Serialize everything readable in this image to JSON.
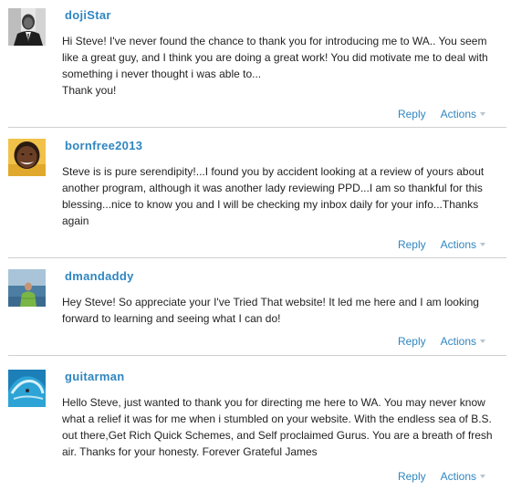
{
  "comments": [
    {
      "username": "dojiStar",
      "avatar": "avatar-man-in-suit",
      "paragraphs": [
        "Hi Steve! I've never found the chance to thank you for introducing me to WA.. You seem like a great guy, and I think you are doing a great work! You did motivate me to deal with something i never thought i was able to...",
        "Thank you!"
      ],
      "reply_label": "Reply",
      "actions_label": "Actions"
    },
    {
      "username": "bornfree2013",
      "avatar": "avatar-smiling-woman",
      "paragraphs": [
        "Steve is is pure serendipity!...I found you by accident looking at a review of yours about another program, although it was another lady reviewing PPD...I am so thankful for this blessing...nice to know you and I will be checking my inbox daily for your info...Thanks again"
      ],
      "reply_label": "Reply",
      "actions_label": "Actions"
    },
    {
      "username": "dmandaddy",
      "avatar": "avatar-man-by-sea",
      "paragraphs": [
        "Hey Steve! So appreciate your I've Tried That website! It led me here and I am looking forward to learning and seeing what I can do!"
      ],
      "reply_label": "Reply",
      "actions_label": "Actions"
    },
    {
      "username": "guitarman",
      "avatar": "avatar-ocean-wave",
      "paragraphs": [
        "Hello Steve, just wanted to thank you for directing me here to WA. You may never know what a relief it was for me when i stumbled on your website. With the endless sea of B.S. out there,Get Rich Quick Schemes, and Self proclaimed Gurus. You are a breath of fresh air. Thanks for your honesty. Forever Grateful James"
      ],
      "reply_label": "Reply",
      "actions_label": "Actions"
    }
  ]
}
